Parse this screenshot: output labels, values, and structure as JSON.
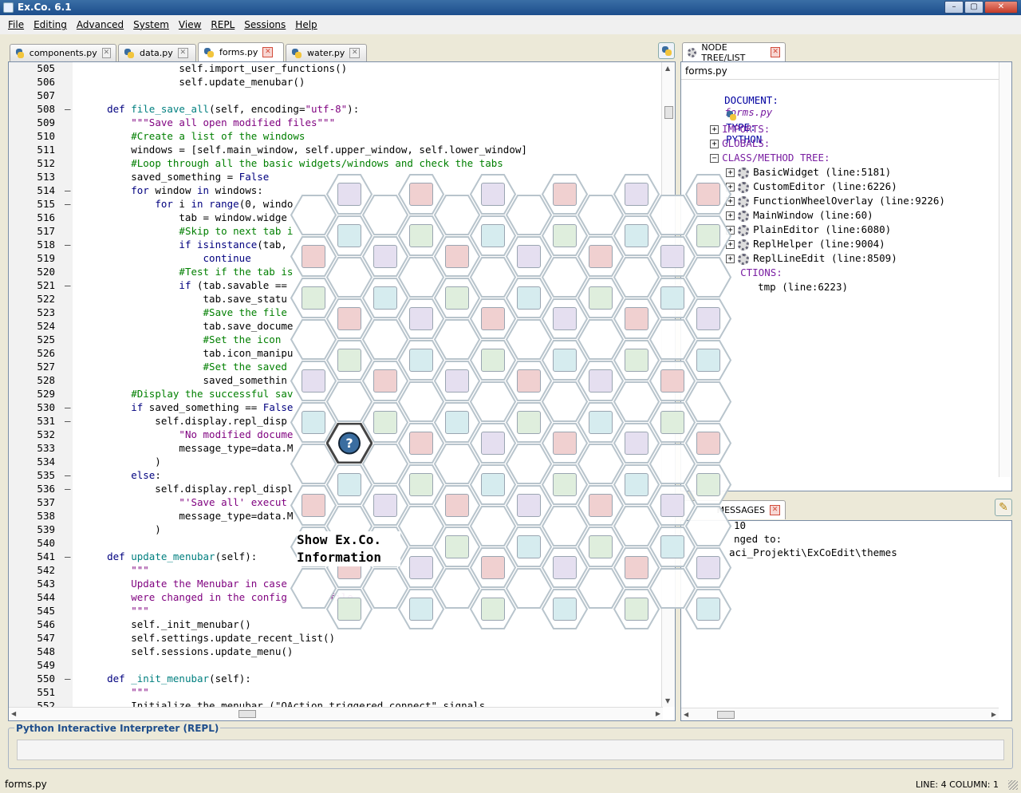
{
  "window": {
    "title": "Ex.Co. 6.1",
    "min": "–",
    "max": "▢",
    "close": "✕"
  },
  "menu": [
    "File",
    "Editing",
    "Advanced",
    "System",
    "View",
    "REPL",
    "Sessions",
    "Help"
  ],
  "editor_tabs": [
    {
      "label": "components.py",
      "active": false
    },
    {
      "label": "data.py",
      "active": false
    },
    {
      "label": "forms.py",
      "active": true
    },
    {
      "label": "water.py",
      "active": false
    }
  ],
  "code_lines": [
    {
      "n": "505",
      "f": "",
      "c": [
        [
          "                self.import_user_functions()",
          ""
        ]
      ]
    },
    {
      "n": "506",
      "f": "",
      "c": [
        [
          "                self.update_menubar()",
          ""
        ]
      ]
    },
    {
      "n": "507",
      "f": "",
      "c": [
        [
          "",
          ""
        ]
      ]
    },
    {
      "n": "508",
      "f": "–",
      "c": [
        [
          "    ",
          ""
        ],
        [
          "def ",
          "kw"
        ],
        [
          "file_save_all",
          "fn"
        ],
        [
          "(self, encoding=",
          ""
        ],
        [
          "\"utf-8\"",
          "str"
        ],
        [
          "):",
          ""
        ]
      ]
    },
    {
      "n": "509",
      "f": "",
      "c": [
        [
          "        ",
          ""
        ],
        [
          "\"\"\"Save all open modified files\"\"\"",
          "str"
        ]
      ]
    },
    {
      "n": "510",
      "f": "",
      "c": [
        [
          "        ",
          ""
        ],
        [
          "#Create a list of the windows",
          "cmt"
        ]
      ]
    },
    {
      "n": "511",
      "f": "",
      "c": [
        [
          "        windows = [self.main_window, self.upper_window, self.lower_window]",
          ""
        ]
      ]
    },
    {
      "n": "512",
      "f": "",
      "c": [
        [
          "        ",
          ""
        ],
        [
          "#Loop through all the basic widgets/windows and check the tabs",
          "cmt"
        ]
      ]
    },
    {
      "n": "513",
      "f": "",
      "c": [
        [
          "        saved_something = ",
          ""
        ],
        [
          "False",
          "kw"
        ]
      ]
    },
    {
      "n": "514",
      "f": "–",
      "c": [
        [
          "        ",
          ""
        ],
        [
          "for ",
          "kw"
        ],
        [
          "window ",
          ""
        ],
        [
          "in ",
          "kw"
        ],
        [
          "windows:",
          ""
        ]
      ]
    },
    {
      "n": "515",
      "f": "–",
      "c": [
        [
          "            ",
          ""
        ],
        [
          "for ",
          "kw"
        ],
        [
          "i ",
          ""
        ],
        [
          "in ",
          "kw"
        ],
        [
          "range",
          "kw"
        ],
        [
          "(0, windo",
          ""
        ]
      ]
    },
    {
      "n": "516",
      "f": "",
      "c": [
        [
          "                tab = window.widge",
          ""
        ]
      ]
    },
    {
      "n": "517",
      "f": "",
      "c": [
        [
          "                ",
          ""
        ],
        [
          "#Skip to next tab i",
          "cmt"
        ]
      ]
    },
    {
      "n": "518",
      "f": "–",
      "c": [
        [
          "                ",
          ""
        ],
        [
          "if ",
          "kw"
        ],
        [
          "isinstance",
          "kw"
        ],
        [
          "(tab,",
          ""
        ]
      ]
    },
    {
      "n": "519",
      "f": "",
      "c": [
        [
          "                    ",
          ""
        ],
        [
          "continue",
          "kw"
        ]
      ]
    },
    {
      "n": "520",
      "f": "",
      "c": [
        [
          "                ",
          ""
        ],
        [
          "#Test if the tab is",
          "cmt"
        ]
      ]
    },
    {
      "n": "521",
      "f": "–",
      "c": [
        [
          "                ",
          ""
        ],
        [
          "if ",
          "kw"
        ],
        [
          "(tab.savable ==",
          ""
        ]
      ]
    },
    {
      "n": "522",
      "f": "",
      "c": [
        [
          "                    tab.save_statu",
          ""
        ]
      ]
    },
    {
      "n": "523",
      "f": "",
      "c": [
        [
          "                    ",
          ""
        ],
        [
          "#Save the file",
          "cmt"
        ]
      ]
    },
    {
      "n": "524",
      "f": "",
      "c": [
        [
          "                    tab.save_docume",
          ""
        ]
      ]
    },
    {
      "n": "525",
      "f": "",
      "c": [
        [
          "                    ",
          ""
        ],
        [
          "#Set the icon",
          "cmt"
        ]
      ]
    },
    {
      "n": "526",
      "f": "",
      "c": [
        [
          "                    tab.icon_manipu",
          ""
        ]
      ]
    },
    {
      "n": "527",
      "f": "",
      "c": [
        [
          "                    ",
          ""
        ],
        [
          "#Set the saved",
          "cmt"
        ]
      ]
    },
    {
      "n": "528",
      "f": "",
      "c": [
        [
          "                    saved_somethin",
          ""
        ]
      ]
    },
    {
      "n": "529",
      "f": "",
      "c": [
        [
          "        ",
          ""
        ],
        [
          "#Display the successful sav",
          "cmt"
        ]
      ]
    },
    {
      "n": "530",
      "f": "–",
      "c": [
        [
          "        ",
          ""
        ],
        [
          "if ",
          "kw"
        ],
        [
          "saved_something == ",
          ""
        ],
        [
          "False",
          "kw"
        ]
      ]
    },
    {
      "n": "531",
      "f": "–",
      "c": [
        [
          "            self.display.repl_disp",
          ""
        ]
      ]
    },
    {
      "n": "532",
      "f": "",
      "c": [
        [
          "                ",
          ""
        ],
        [
          "\"No modified docume",
          "str"
        ]
      ]
    },
    {
      "n": "533",
      "f": "",
      "c": [
        [
          "                message_type=data.M",
          ""
        ]
      ]
    },
    {
      "n": "534",
      "f": "",
      "c": [
        [
          "            )",
          ""
        ]
      ]
    },
    {
      "n": "535",
      "f": "–",
      "c": [
        [
          "        ",
          ""
        ],
        [
          "else",
          "kw"
        ],
        [
          ":",
          ""
        ]
      ]
    },
    {
      "n": "536",
      "f": "–",
      "c": [
        [
          "            self.display.repl_displ",
          ""
        ]
      ]
    },
    {
      "n": "537",
      "f": "",
      "c": [
        [
          "                ",
          ""
        ],
        [
          "\"'Save all' execut",
          "str"
        ]
      ]
    },
    {
      "n": "538",
      "f": "",
      "c": [
        [
          "                message_type=data.M",
          ""
        ]
      ]
    },
    {
      "n": "539",
      "f": "",
      "c": [
        [
          "            )",
          ""
        ]
      ]
    },
    {
      "n": "540",
      "f": "",
      "c": [
        [
          "",
          ""
        ]
      ]
    },
    {
      "n": "541",
      "f": "–",
      "c": [
        [
          "    ",
          ""
        ],
        [
          "def ",
          "kw"
        ],
        [
          "update_menubar",
          "fn"
        ],
        [
          "(self):",
          ""
        ]
      ]
    },
    {
      "n": "542",
      "f": "",
      "c": [
        [
          "        ",
          ""
        ],
        [
          "\"\"\"",
          "str"
        ]
      ]
    },
    {
      "n": "543",
      "f": "",
      "c": [
        [
          "        ",
          ""
        ],
        [
          "Update the Menubar in case",
          "str"
        ]
      ]
    },
    {
      "n": "544",
      "f": "",
      "c": [
        [
          "        ",
          ""
        ],
        [
          "were changed in the config       file",
          "str"
        ]
      ]
    },
    {
      "n": "545",
      "f": "",
      "c": [
        [
          "        ",
          ""
        ],
        [
          "\"\"\"",
          "str"
        ]
      ]
    },
    {
      "n": "546",
      "f": "",
      "c": [
        [
          "        self._init_menubar()",
          ""
        ]
      ]
    },
    {
      "n": "547",
      "f": "",
      "c": [
        [
          "        self.settings.update_recent_list()",
          ""
        ]
      ]
    },
    {
      "n": "548",
      "f": "",
      "c": [
        [
          "        self.sessions.update_menu()",
          ""
        ]
      ]
    },
    {
      "n": "549",
      "f": "",
      "c": [
        [
          "",
          ""
        ]
      ]
    },
    {
      "n": "550",
      "f": "–",
      "c": [
        [
          "    ",
          ""
        ],
        [
          "def ",
          "kw"
        ],
        [
          "_init_menubar",
          "fn"
        ],
        [
          "(self):",
          ""
        ]
      ]
    },
    {
      "n": "551",
      "f": "",
      "c": [
        [
          "        ",
          ""
        ],
        [
          "\"\"\"",
          "str"
        ]
      ]
    },
    {
      "n": "552",
      "f": "",
      "c": [
        [
          "        Initialize the menubar (\"QAction.triggered.connect\" signals",
          ""
        ]
      ]
    }
  ],
  "tree_tab": {
    "label": "NODE TREE/LIST"
  },
  "tree": {
    "header": "forms.py",
    "document": {
      "label": "DOCUMENT:",
      "value": "forms.py"
    },
    "type": {
      "label": "TYPE:",
      "value": "PYTHON"
    },
    "imports": "IMPORTS:",
    "globals": "GLOBALS:",
    "class_tree": "CLASS/METHOD TREE:",
    "classes": [
      "BasicWidget (line:5181)",
      "CustomEditor (line:6226)",
      "FunctionWheelOverlay (line:9226)",
      "MainWindow (line:60)",
      "PlainEditor (line:6080)",
      "ReplHelper (line:9004)",
      "ReplLineEdit (line:8509)"
    ],
    "functions": "CTIONS:",
    "func_items": [
      "tmp (line:6223)"
    ]
  },
  "messages_tab": {
    "label": "MESSAGES"
  },
  "messages": [
    "10",
    "nged to:",
    "aci_Projekti\\ExCoEdit\\themes"
  ],
  "repl": {
    "title": "Python Interactive Interpreter (REPL)",
    "value": ""
  },
  "status": {
    "file": "forms.py",
    "position": "LINE: 4 COLUMN: 1"
  },
  "hex_menu": {
    "tooltip_line1": "Show Ex.Co.",
    "tooltip_line2": "Information"
  }
}
